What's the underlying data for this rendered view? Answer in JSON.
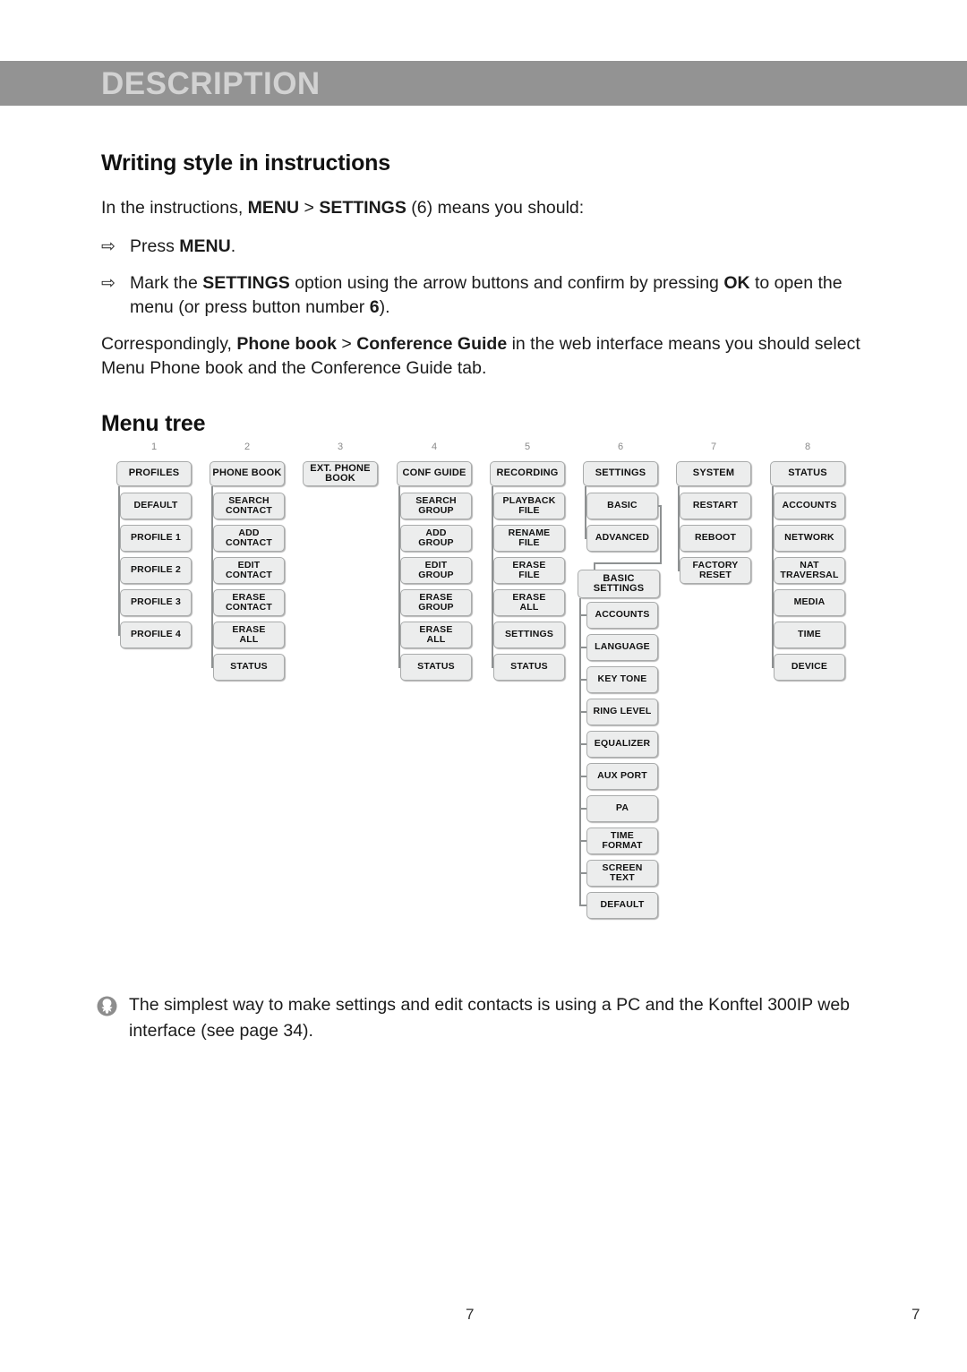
{
  "header": {
    "title": "DESCRIPTION"
  },
  "sections": {
    "writing_style": {
      "heading": "Writing style in instructions",
      "intro_plain_1": "In the instructions, ",
      "intro_bold_1": "MENU",
      "intro_plain_2": " > ",
      "intro_bold_2": "SETTINGS",
      "intro_plain_3": " (6) means you should:",
      "bullets": [
        {
          "arrow": "arrow-right-icon",
          "plain_1": "Press ",
          "bold_1": "MENU",
          "plain_2": "."
        },
        {
          "arrow": "arrow-right-icon",
          "plain_1": "Mark the ",
          "bold_1": "SETTINGS",
          "plain_2": " option using the arrow buttons and confirm by pressing ",
          "bold_2": "OK",
          "plain_3": " to open the menu (or press button number ",
          "bold_3": "6",
          "plain_4": ")."
        }
      ],
      "closing_plain_1": "Correspondingly, ",
      "closing_bold_1": "Phone book",
      "closing_plain_2": " > ",
      "closing_bold_2": "Conference Guide",
      "closing_plain_3": " in the web interface means you should select Menu Phone book and the Conference Guide tab."
    },
    "menu_tree": {
      "heading": "Menu tree"
    }
  },
  "tree": {
    "column_numbers": [
      "1",
      "2",
      "3",
      "4",
      "5",
      "6",
      "7",
      "8"
    ],
    "columns": [
      {
        "number": "1",
        "root": "PROFILES",
        "children": [
          "DEFAULT",
          "PROFILE 1",
          "PROFILE 2",
          "PROFILE 3",
          "PROFILE 4"
        ]
      },
      {
        "number": "2",
        "root": "PHONE BOOK",
        "children": [
          "SEARCH\nCONTACT",
          "ADD\nCONTACT",
          "EDIT\nCONTACT",
          "ERASE\nCONTACT",
          "ERASE\nALL",
          "STATUS"
        ]
      },
      {
        "number": "3",
        "root": "EXT. PHONE BOOK",
        "children": []
      },
      {
        "number": "4",
        "root": "CONF GUIDE",
        "children": [
          "SEARCH\nGROUP",
          "ADD\nGROUP",
          "EDIT\nGROUP",
          "ERASE\nGROUP",
          "ERASE\nALL",
          "STATUS"
        ]
      },
      {
        "number": "5",
        "root": "RECORDING",
        "children": [
          "PLAYBACK\nFILE",
          "RENAME\nFILE",
          "ERASE\nFILE",
          "ERASE\nALL",
          "SETTINGS",
          "STATUS"
        ]
      },
      {
        "number": "6",
        "root": "SETTINGS",
        "children": [
          "BASIC",
          "ADVANCED"
        ],
        "sub_root": "BASIC\nSETTINGS",
        "sub_children": [
          "ACCOUNTS",
          "LANGUAGE",
          "KEY TONE",
          "RING LEVEL",
          "EQUALIZER",
          "AUX PORT",
          "PA",
          "TIME\nFORMAT",
          "SCREEN\nTEXT",
          "DEFAULT"
        ]
      },
      {
        "number": "7",
        "root": "SYSTEM",
        "children": [
          "RESTART",
          "REBOOT",
          "FACTORY\nRESET"
        ]
      },
      {
        "number": "8",
        "root": "STATUS",
        "children": [
          "ACCOUNTS",
          "NETWORK",
          "NAT\nTRAVERSAL",
          "MEDIA",
          "TIME",
          "DEVICE"
        ]
      }
    ]
  },
  "note": {
    "icon": "info-star-icon",
    "text": "The simplest way to make settings and edit contacts is using a PC and the Konftel 300IP web interface (see page 34)."
  },
  "footer": {
    "page_number_center": "7",
    "page_number_right": "7"
  },
  "colors": {
    "header_bar": "#939393",
    "header_text": "#d2d2d2",
    "node_fill": "#eceded",
    "node_border": "#a9abab",
    "connector": "#8e9192",
    "column_number": "#8a8a8a"
  }
}
